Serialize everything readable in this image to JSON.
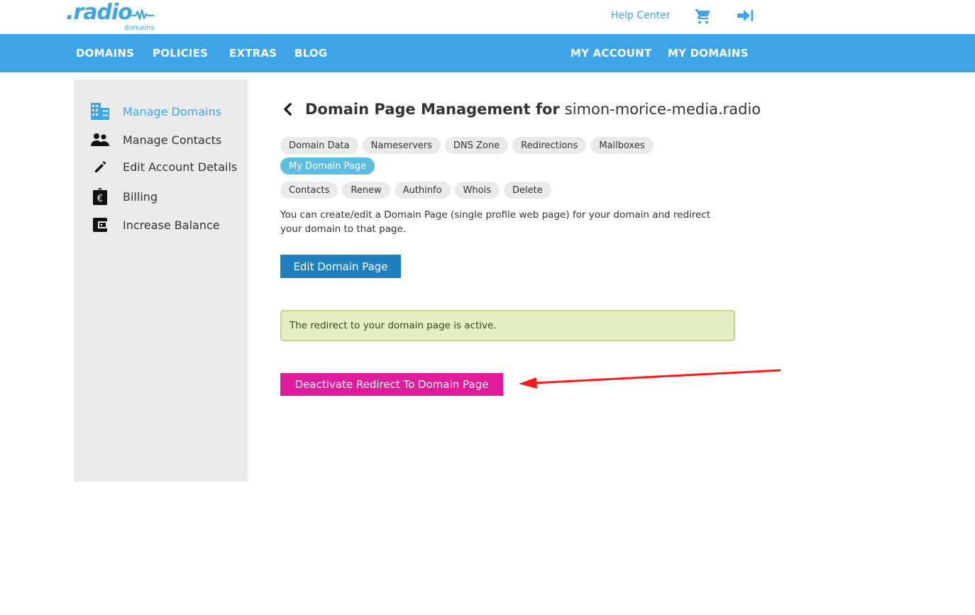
{
  "header": {
    "logo": {
      "word": ".radio",
      "sub": "domains"
    },
    "help_center": "Help Center",
    "icons": [
      "cart-icon",
      "login-icon"
    ]
  },
  "nav": {
    "left": [
      "DOMAINS",
      "POLICIES",
      "EXTRAS",
      "BLOG"
    ],
    "right": [
      "MY ACCOUNT",
      "MY DOMAINS"
    ]
  },
  "sidebar": {
    "items": [
      {
        "label": "Manage Domains",
        "icon": "building-icon",
        "active": true
      },
      {
        "label": "Manage Contacts",
        "icon": "people-icon",
        "active": false
      },
      {
        "label": "Edit Account Details",
        "icon": "pencil-icon",
        "active": false
      },
      {
        "label": "Billing",
        "icon": "euro-clipboard-icon",
        "active": false
      },
      {
        "label": "Increase Balance",
        "icon": "wallet-icon",
        "active": false
      }
    ]
  },
  "main": {
    "title_prefix": "Domain Page Management for",
    "domain": "simon-morice-media.radio",
    "tabs": [
      {
        "label": "Domain Data",
        "active": false
      },
      {
        "label": "Nameservers",
        "active": false
      },
      {
        "label": "DNS Zone",
        "active": false
      },
      {
        "label": "Redirections",
        "active": false
      },
      {
        "label": "Mailboxes",
        "active": false
      },
      {
        "label": "My Domain Page",
        "active": true
      },
      {
        "label": "Contacts",
        "active": false
      },
      {
        "label": "Renew",
        "active": false
      },
      {
        "label": "Authinfo",
        "active": false
      },
      {
        "label": "Whois",
        "active": false
      },
      {
        "label": "Delete",
        "active": false
      }
    ],
    "description": "You can create/edit a Domain Page (single profile web page) for your domain and redirect your domain to that page.",
    "edit_button": "Edit Domain Page",
    "alert": "The redirect to your domain page is active.",
    "deactivate_button": "Deactivate Redirect To Domain Page"
  },
  "colors": {
    "brand_blue": "#3da5e6",
    "active_tab": "#5bbde0",
    "edit_button": "#1f80c0",
    "deactivate_button": "#e01b9b",
    "alert_bg": "#e3eec2",
    "annotation_arrow": "#ff0000"
  }
}
